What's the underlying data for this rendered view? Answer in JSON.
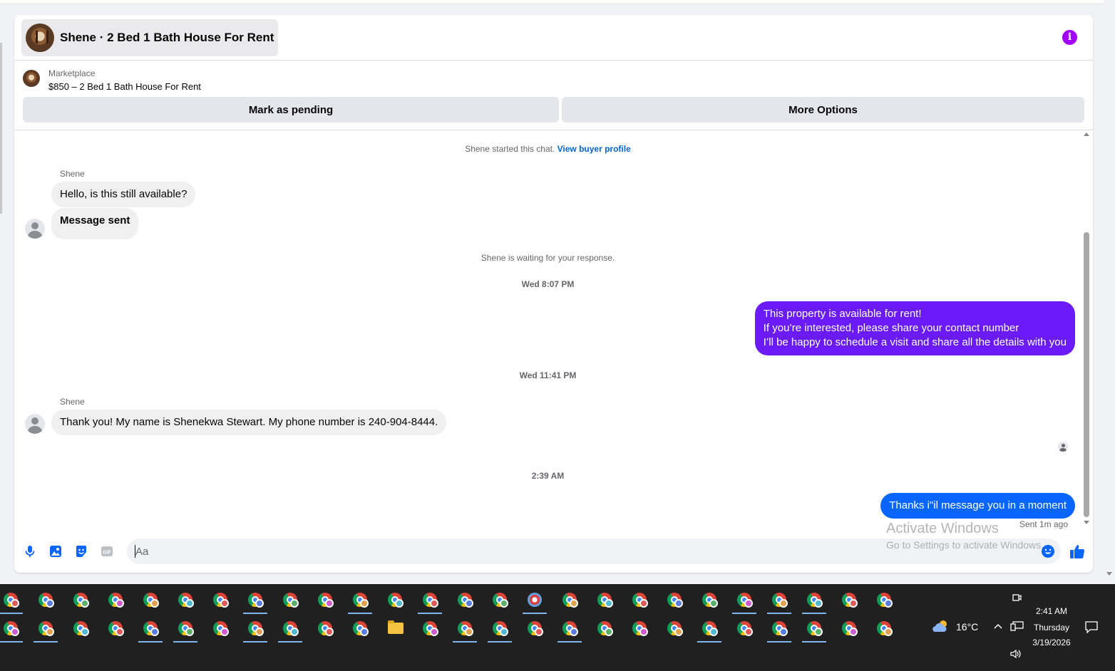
{
  "chat": {
    "title": "Shene · 2 Bed 1 Bath House For Rent",
    "listing_label": "Marketplace",
    "listing_price": "$850 – 2 Bed 1 Bath House For Rent",
    "mark_pending": "Mark as pending",
    "more_options": "More Options"
  },
  "thread": {
    "started_text": "Shene started this chat.",
    "view_buyer_profile": "View buyer profile",
    "sender_name": "Shene",
    "msg1": "Hello, is this still available?",
    "msg2": "Message sent",
    "waiting": "Shene is waiting for your response.",
    "ts1": "Wed 8:07 PM",
    "out1_line1": "This property is available for rent!",
    "out1_line2": "If you’re interested, please share your contact number",
    "out1_line3": "I’ll be happy to schedule a visit and share all the details with you",
    "ts2": "Wed 11:41 PM",
    "msg3": "Thank you! My name is Shenekwa Stewart. My phone number is 240-904-8444.",
    "ts3": "2:39 AM",
    "out2": "Thanks i\"il message you in a moment",
    "sent_status": "Sent 1m ago",
    "bubble_out_purple": "#6a1bf7",
    "bubble_out_blue": "#0866ff"
  },
  "composer": {
    "placeholder": "Aa",
    "icons": [
      "microphone-icon",
      "photo-icon",
      "sticker-icon",
      "gif-icon",
      "emoji-icon",
      "thumbs-up-icon"
    ]
  },
  "watermark": {
    "line1": "Activate Windows",
    "line2": "Go to Settings to activate Windows."
  },
  "taskbar": {
    "temperature": "16°C",
    "time": "2:41 AM",
    "day": "Thursday",
    "date": "3/19/2026"
  }
}
